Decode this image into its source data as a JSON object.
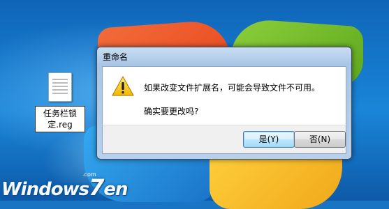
{
  "desktop": {
    "icon_label": "任务栏锁定.reg",
    "watermark": {
      "text_before": "Windows",
      "seven": "7",
      "text_after": "en",
      "small": ".com"
    }
  },
  "dialog": {
    "title": "重命名",
    "message_line1": "如果改变文件扩展名，可能会导致文件不可用。",
    "message_line2": "确实要更改吗?",
    "buttons": {
      "yes": "是(Y)",
      "no": "否(N)"
    },
    "icon": "warning-icon"
  }
}
